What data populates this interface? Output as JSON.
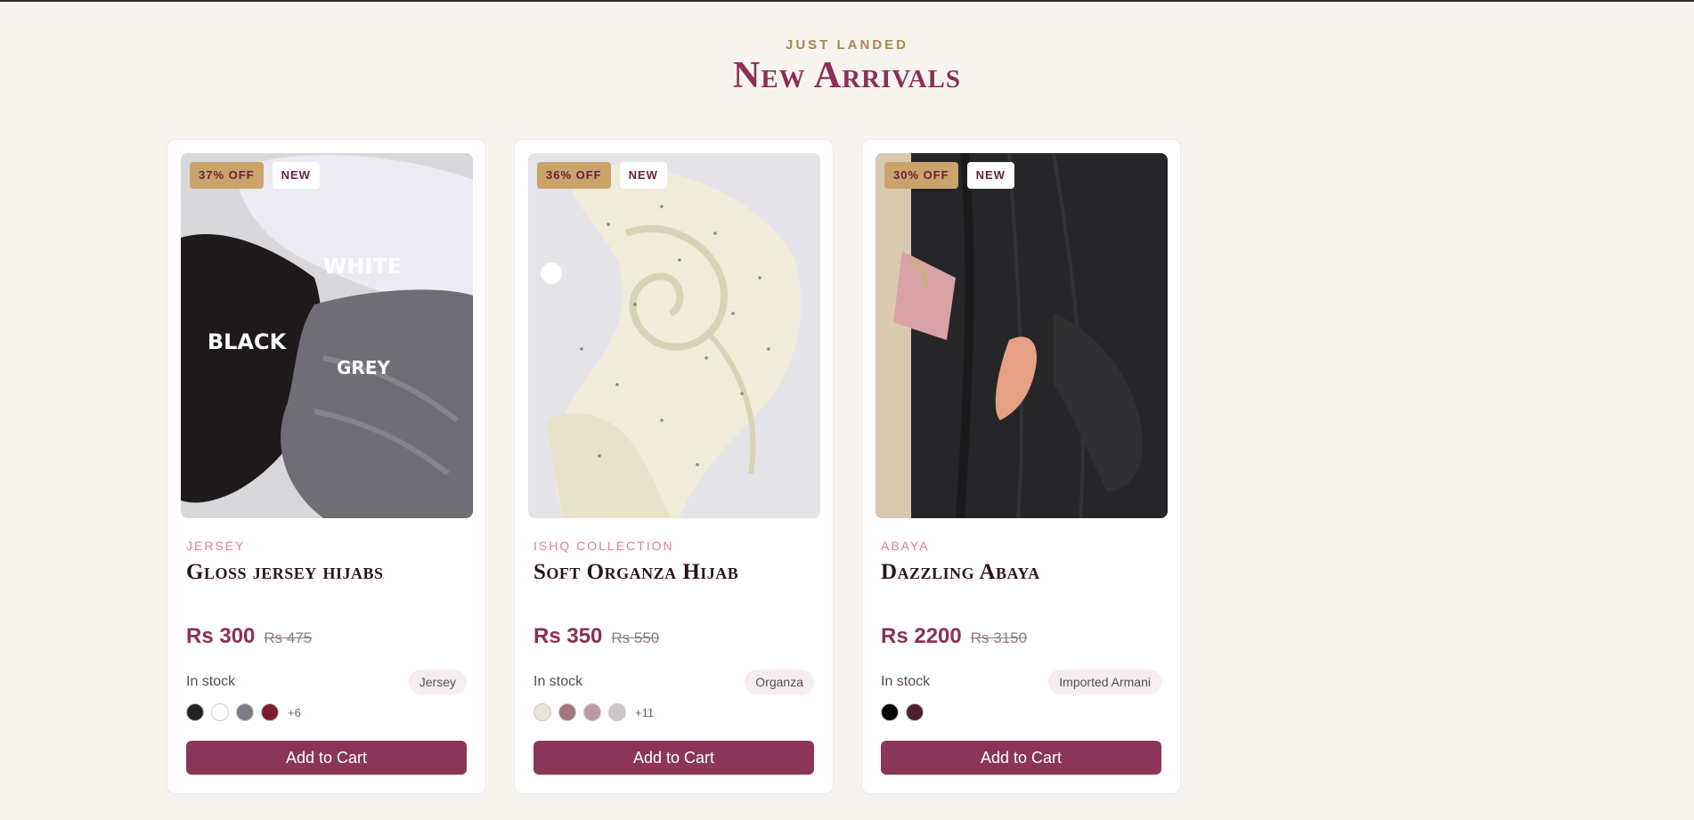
{
  "section": {
    "eyebrow": "JUST LANDED",
    "title": "New Arrivals"
  },
  "colors": {
    "brand": "#8b2f57",
    "button": "#8b3659",
    "accent_gold": "#a8884c",
    "category_pink": "#e07aa0",
    "background": "#f7f4ef"
  },
  "products": [
    {
      "discount": "37% OFF",
      "new_label": "NEW",
      "image_text": [
        "WHITE",
        "BLACK",
        "GREY"
      ],
      "category": "JERSEY",
      "name": "Gloss jersey hijabs",
      "price": "Rs 300",
      "old_price": "Rs 475",
      "stock": "In stock",
      "tag": "Jersey",
      "swatches": [
        "#222222",
        "#ffffff",
        "#7a7d87",
        "#7a1c32"
      ],
      "more": "+6",
      "button": "Add to Cart"
    },
    {
      "discount": "36% OFF",
      "new_label": "NEW",
      "category": "ISHQ COLLECTION",
      "name": "Soft Organza Hijab",
      "price": "Rs 350",
      "old_price": "Rs 550",
      "stock": "In stock",
      "tag": "Organza",
      "swatches": [
        "#e8e6d6",
        "#a5767e",
        "#b99ca2",
        "#cfc6cc"
      ],
      "more": "+11",
      "button": "Add to Cart"
    },
    {
      "discount": "30% OFF",
      "new_label": "NEW",
      "category": "ABAYA",
      "name": "Dazzling Abaya",
      "price": "Rs 2200",
      "old_price": "Rs 3150",
      "stock": "In stock",
      "tag": "Imported Armani",
      "swatches": [
        "#000000",
        "#4a2030"
      ],
      "button": "Add to Cart"
    }
  ]
}
